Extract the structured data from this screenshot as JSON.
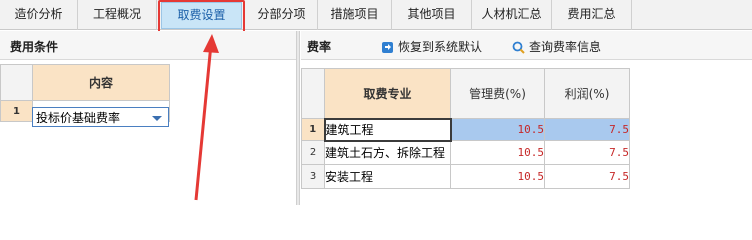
{
  "tabs": [
    {
      "label": "造价分析"
    },
    {
      "label": "工程概况"
    },
    {
      "label": "取费设置"
    },
    {
      "label": "分部分项"
    },
    {
      "label": "措施项目"
    },
    {
      "label": "其他项目"
    },
    {
      "label": "人材机汇总"
    },
    {
      "label": "费用汇总"
    }
  ],
  "active_tab": "取费设置",
  "left_panel": {
    "title": "费用条件",
    "column_header": "内容",
    "rows": [
      {
        "num": "1",
        "value": "投标价基础费率"
      }
    ]
  },
  "right_panel": {
    "title": "费率",
    "restore_label": "恢复到系统默认",
    "query_label": "查询费率信息",
    "columns": [
      "取费专业",
      "管理费(%)",
      "利润(%)"
    ],
    "rows": [
      {
        "num": "1",
        "name": "建筑工程",
        "mgmt": "10.5",
        "profit": "7.5"
      },
      {
        "num": "2",
        "name": "建筑土石方、拆除工程",
        "mgmt": "10.5",
        "profit": "7.5"
      },
      {
        "num": "3",
        "name": "安装工程",
        "mgmt": "10.5",
        "profit": "7.5"
      }
    ]
  },
  "colors": {
    "accent_red": "#e53935",
    "header_fill": "#fae3c5",
    "selection_blue": "#a9c9ee",
    "value_red": "#c62828"
  }
}
